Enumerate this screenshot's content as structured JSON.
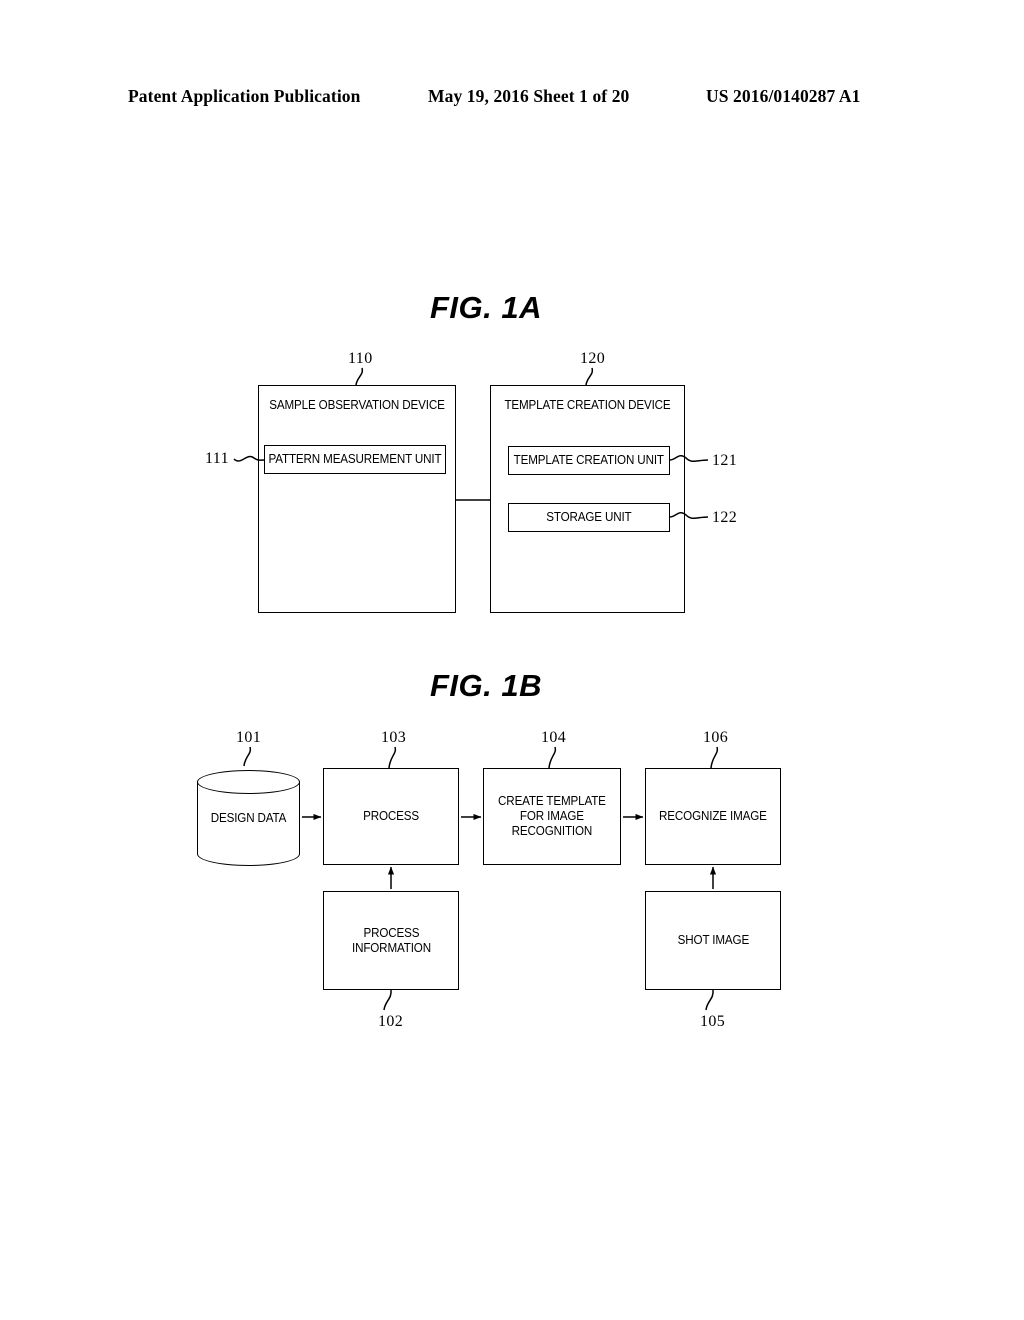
{
  "header": {
    "left": "Patent Application Publication",
    "middle": "May 19, 2016  Sheet 1 of 20",
    "right": "US 2016/0140287 A1"
  },
  "figures": [
    {
      "title": "FIG. 1A",
      "boxes": {
        "sample_observation_device": {
          "label": "SAMPLE OBSERVATION DEVICE",
          "ref": "110"
        },
        "template_creation_device": {
          "label": "TEMPLATE CREATION DEVICE",
          "ref": "120"
        },
        "pattern_measurement_unit": {
          "label": "PATTERN MEASUREMENT UNIT",
          "ref": "111"
        },
        "template_creation_unit": {
          "label": "TEMPLATE CREATION UNIT",
          "ref": "121"
        },
        "storage_unit": {
          "label": "STORAGE UNIT",
          "ref": "122"
        }
      }
    },
    {
      "title": "FIG. 1B",
      "nodes": {
        "design_data": {
          "label": "DESIGN DATA",
          "ref": "101",
          "shape": "cylinder"
        },
        "process_information": {
          "label": "PROCESS\nINFORMATION",
          "line1": "PROCESS",
          "line2": "INFORMATION",
          "ref": "102",
          "shape": "rect"
        },
        "process": {
          "label": "PROCESS",
          "ref": "103",
          "shape": "rect"
        },
        "create_template": {
          "label": "CREATE TEMPLATE FOR IMAGE RECOGNITION",
          "line1": "CREATE TEMPLATE",
          "line2": "FOR IMAGE",
          "line3": "RECOGNITION",
          "ref": "104",
          "shape": "rect"
        },
        "shot_image": {
          "label": "SHOT IMAGE",
          "ref": "105",
          "shape": "rect"
        },
        "recognize_image": {
          "label": "RECOGNIZE IMAGE",
          "ref": "106",
          "shape": "rect"
        }
      },
      "flow": [
        {
          "from": "design_data",
          "to": "process",
          "direction": "right"
        },
        {
          "from": "process",
          "to": "create_template",
          "direction": "right"
        },
        {
          "from": "create_template",
          "to": "recognize_image",
          "direction": "right"
        },
        {
          "from": "process_information",
          "to": "process",
          "direction": "up"
        },
        {
          "from": "shot_image",
          "to": "recognize_image",
          "direction": "up"
        }
      ]
    }
  ],
  "colors": {
    "ink": "#000000",
    "paper": "#ffffff"
  }
}
